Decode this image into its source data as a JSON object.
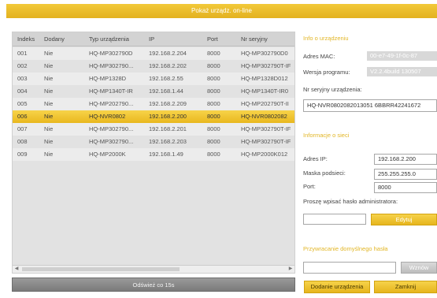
{
  "window": {
    "title": "Pokaż urządz. on-line"
  },
  "table": {
    "columns": [
      "Indeks",
      "Dodany",
      "Typ urządzenia",
      "IP",
      "Port",
      "Nr seryjny"
    ],
    "rows": [
      [
        "001",
        "Nie",
        "HQ-MP302790D",
        "192.168.2.204",
        "8000",
        "HQ-MP302790D0"
      ],
      [
        "002",
        "Nie",
        "HQ-MP302790...",
        "192.168.2.202",
        "8000",
        "HQ-MP302790T-IF"
      ],
      [
        "003",
        "Nie",
        "HQ-MP1328D",
        "192.168.2.55",
        "8000",
        "HQ-MP1328D012"
      ],
      [
        "004",
        "Nie",
        "HQ-MP1340T-IR",
        "192.168.1.44",
        "8000",
        "HQ-MP1340T-IR0"
      ],
      [
        "005",
        "Nie",
        "HQ-MP202790...",
        "192.168.2.209",
        "8000",
        "HQ-MP202790T-II"
      ],
      [
        "006",
        "Nie",
        "HQ-NVR0802",
        "192.168.2.200",
        "8000",
        "HQ-NVR0802082"
      ],
      [
        "007",
        "Nie",
        "HQ-MP302790...",
        "192.168.2.201",
        "8000",
        "HQ-MP302790T-IF"
      ],
      [
        "008",
        "Nie",
        "HQ-MP302790...",
        "192.168.2.203",
        "8000",
        "HQ-MP302790T-IF"
      ],
      [
        "009",
        "Nie",
        "HQ-MP2000K",
        "192.168.1.49",
        "8000",
        "HQ-MP2000K012"
      ]
    ],
    "selected_row": 5
  },
  "refresh_button": "Odśwież co 15s",
  "device_info": {
    "title": "Info o urządzeniu",
    "mac_label": "Adres MAC:",
    "mac_value": "00-e7-49-1f-0c-87",
    "version_label": "Wersja programu:",
    "version_value": "V2.2.4build 130507",
    "serial_label": "Nr seryjny urządzenia:",
    "serial_value": "HQ-NVR0802082013051 6BBRR42241672"
  },
  "network": {
    "title": "Informacje o sieci",
    "ip_label": "Adres IP:",
    "ip_value": "192.168.2.200",
    "mask_label": "Maska podsieci:",
    "mask_value": "255.255.255.0",
    "port_label": "Port:",
    "port_value": "8000",
    "admin_prompt": "Proszę wpisać hasło administratora:",
    "edit_button": "Edytuj"
  },
  "restore": {
    "title": "Przywracanie domyślnego hasła",
    "import_button": "Wznów"
  },
  "add_button": "Dodanie urządzenia",
  "close_button": "Zamknij",
  "colors": {
    "accent": "#e9b81e",
    "selected_row": "#f2c93a"
  }
}
